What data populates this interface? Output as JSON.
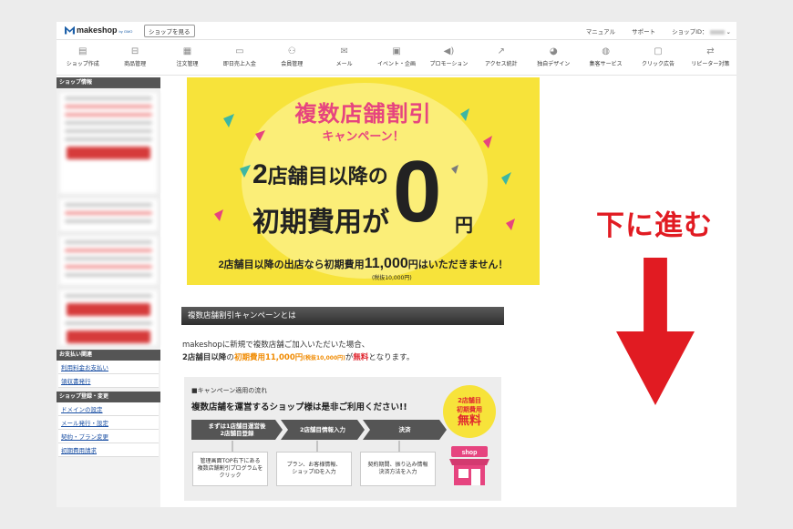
{
  "topbar": {
    "logo_text": "makeshop",
    "logo_sub": "by GMO",
    "shop_button": "ショップを見る",
    "links": [
      "マニュアル",
      "サポート"
    ],
    "shop_id_label": "ショップID：",
    "dropdown_caret": "⌄"
  },
  "nav": {
    "items": [
      {
        "label": "ショップ作成",
        "icon": "store-icon",
        "glyph": "▤"
      },
      {
        "label": "商品管理",
        "icon": "basket-icon",
        "glyph": "⊟"
      },
      {
        "label": "注文管理",
        "icon": "clipboard-icon",
        "glyph": "▦"
      },
      {
        "label": "即日売上入金",
        "icon": "folder-icon",
        "glyph": "▭"
      },
      {
        "label": "会員管理",
        "icon": "users-icon",
        "glyph": "⚇"
      },
      {
        "label": "メール",
        "icon": "mail-icon",
        "glyph": "✉"
      },
      {
        "label": "イベント・企画",
        "icon": "calendar-icon",
        "glyph": "▣"
      },
      {
        "label": "プロモーション",
        "icon": "megaphone-icon",
        "glyph": "◀)"
      },
      {
        "label": "アクセス統計",
        "icon": "chart-line-icon",
        "glyph": "↗"
      },
      {
        "label": "独自デザイン",
        "icon": "palette-icon",
        "glyph": "◕"
      },
      {
        "label": "集客サービス",
        "icon": "globe-icon",
        "glyph": "◍"
      },
      {
        "label": "クリック広告",
        "icon": "mouse-icon",
        "glyph": "▢"
      },
      {
        "label": "リピーター対策",
        "icon": "repeat-icon",
        "glyph": "⇄"
      }
    ]
  },
  "sidebar": {
    "shop_info_header": "ショップ情報",
    "payment_header": "お支払い関連",
    "payment_links": [
      "利用料金お支払い",
      "領収書発行"
    ],
    "register_header": "ショップ登録・変更",
    "register_links": [
      "ドメインの設定",
      "メール発行・設定",
      "契約・プラン変更",
      "初期費用請求"
    ]
  },
  "banner": {
    "title": "複数店舗割引",
    "subtitle": "キャンペーン！",
    "line1_big": "2",
    "line1": "店舗目以降の",
    "line2": "初期費用が",
    "zero": "0",
    "yen": "円",
    "note_pre": "2店舗目以降の出店なら初期費用",
    "note_amount": "11,000",
    "note_post": "円はいただきません！",
    "tax_note": "(税抜10,000円)"
  },
  "section": {
    "header": "複数店舗割引キャンペーンとは",
    "text1": "makeshopに新規で複数店舗ご加入いただいた場合、",
    "text2_a": "2店舗目以降",
    "text2_b": "の",
    "text2_c": "初期費用11,000円",
    "text2_d": "(税抜10,000円)",
    "text2_e": "が",
    "text2_f": "無料",
    "text2_g": "となります。"
  },
  "flow": {
    "title": "■キャンペーン適用の流れ",
    "headline": "複数店舗を運営するショップ様は是非ご利用ください!!",
    "steps": [
      "まずは1店舗目運営後\n2店舗目登録",
      "2店舗目情報入力",
      "決済"
    ],
    "descriptions": [
      "管理画面TOP右下にある\n複数店舗割引プログラムを\nクリック",
      "プラン、お客様情報、\nショップIDを入力",
      "契約期間、振り込み情報\n決済方法を入力"
    ],
    "badge_line1": "2店舗目",
    "badge_line2": "初期費用",
    "badge_line3": "無料",
    "shop_label": "shop"
  },
  "annotation": {
    "text": "下に進む"
  },
  "colors": {
    "accent_red": "#e11b22",
    "pink": "#e6447f",
    "banner_yellow": "#f7e33a",
    "orange": "#f08a00"
  }
}
